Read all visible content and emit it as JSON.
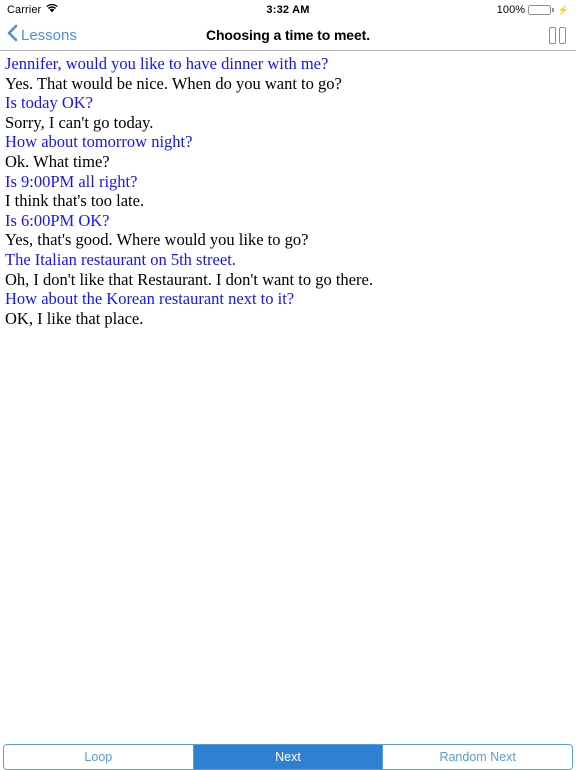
{
  "status_bar": {
    "carrier": "Carrier",
    "wifi_icon": "wifi-icon",
    "time": "3:32 AM",
    "battery_percent": "100%",
    "battery_icon": "battery-icon",
    "charging_icon": "lightning-bolt-icon"
  },
  "nav_bar": {
    "back_icon": "chevron-left-icon",
    "back_label": "Lessons",
    "title": "Choosing a time to meet.",
    "right_icon": "pause-icon"
  },
  "dialogue": {
    "lines": [
      {
        "text": "Jennifer, would you like to have dinner with me?",
        "speaker": "question"
      },
      {
        "text": "Yes. That would be nice. When do you want to go?",
        "speaker": "answer"
      },
      {
        "text": "Is today OK?",
        "speaker": "question"
      },
      {
        "text": "Sorry, I can't go today.",
        "speaker": "answer"
      },
      {
        "text": "How about tomorrow night?",
        "speaker": "question"
      },
      {
        "text": "Ok. What time?",
        "speaker": "answer"
      },
      {
        "text": "Is 9:00PM all right?",
        "speaker": "question"
      },
      {
        "text": "I think that's too late.",
        "speaker": "answer"
      },
      {
        "text": "Is 6:00PM OK?",
        "speaker": "question"
      },
      {
        "text": "Yes, that's good. Where would you like to go?",
        "speaker": "answer"
      },
      {
        "text": "The Italian restaurant on 5th street.",
        "speaker": "question"
      },
      {
        "text": "Oh, I don't like that Restaurant. I don't want to go there.",
        "speaker": "answer"
      },
      {
        "text": "How about the Korean restaurant next to it?",
        "speaker": "question"
      },
      {
        "text": "OK, I like that place.",
        "speaker": "answer"
      }
    ]
  },
  "toolbar": {
    "segments": [
      {
        "label": "Loop",
        "selected": false
      },
      {
        "label": "Next",
        "selected": true
      },
      {
        "label": "Random Next",
        "selected": false
      }
    ]
  },
  "colors": {
    "question_text": "#1414ff",
    "answer_text": "#000000",
    "tint": "#5a9bd8",
    "selected_segment": "#2e80d3",
    "battery_green": "#4cd964"
  }
}
